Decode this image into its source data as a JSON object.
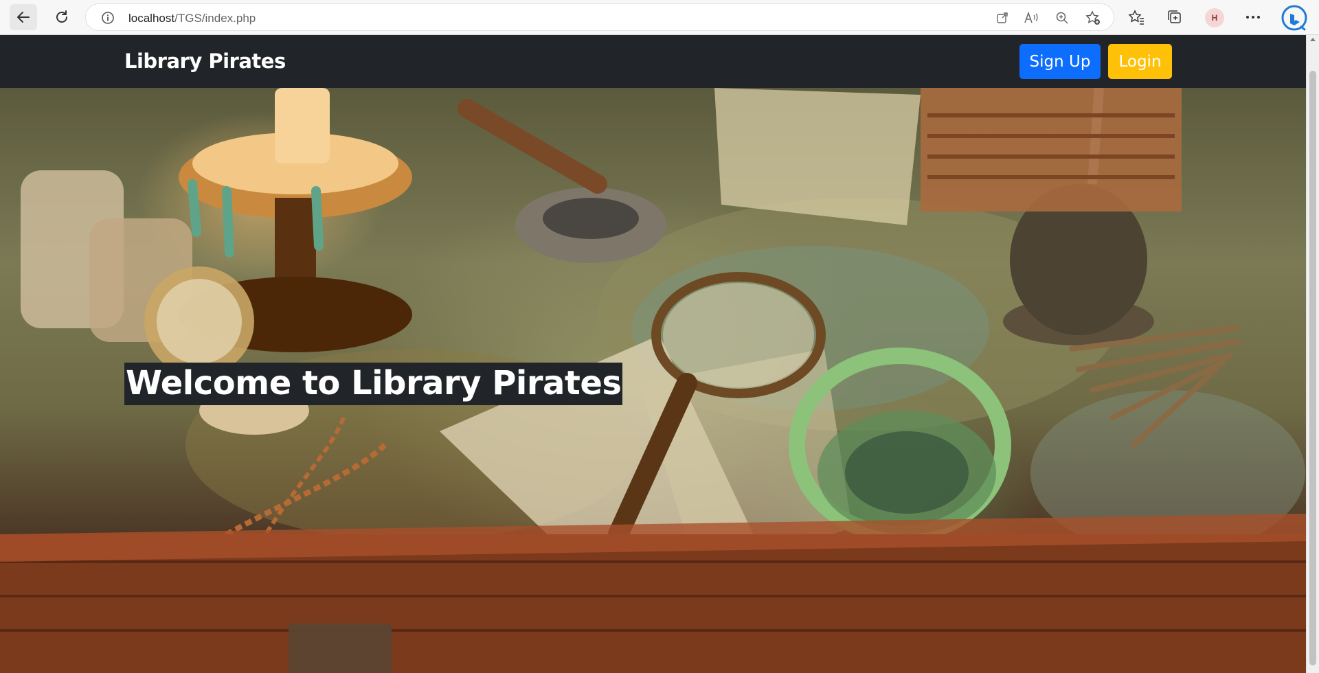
{
  "browser": {
    "url_host": "localhost",
    "url_path": "/TGS/index.php",
    "profile_initial": "H"
  },
  "navbar": {
    "brand": "Library Pirates",
    "signup_label": "Sign Up",
    "login_label": "Login"
  },
  "hero": {
    "title": "Welcome to Library Pirates"
  },
  "colors": {
    "navbar_bg": "#212529",
    "signup_bg": "#0d6efd",
    "login_bg": "#ffc107"
  }
}
